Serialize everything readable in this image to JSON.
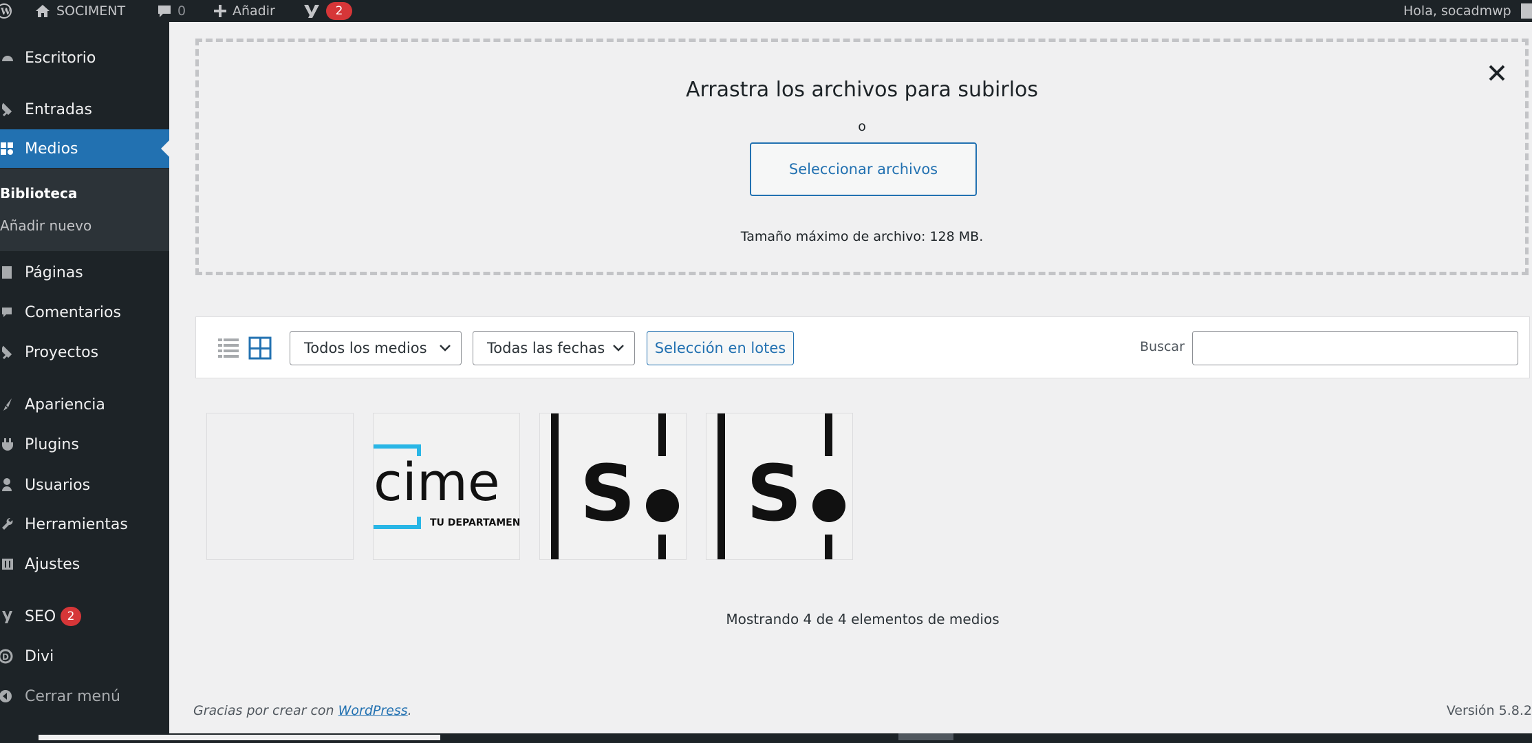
{
  "adminbar": {
    "site_name": "SOCIMENT",
    "comments_count": "0",
    "new_label": "Añadir",
    "yoast_badge": "2",
    "greeting": "Hola, socadmwp"
  },
  "sidebar": {
    "items": [
      {
        "label": "Escritorio",
        "icon": "gauge-icon"
      },
      {
        "label": "Entradas",
        "icon": "pin-icon"
      },
      {
        "label": "Medios",
        "icon": "media-icon"
      },
      {
        "label": "Páginas",
        "icon": "page-icon"
      },
      {
        "label": "Comentarios",
        "icon": "comment-icon"
      },
      {
        "label": "Proyectos",
        "icon": "pin-icon"
      },
      {
        "label": "Apariencia",
        "icon": "brush-icon"
      },
      {
        "label": "Plugins",
        "icon": "plugin-icon"
      },
      {
        "label": "Usuarios",
        "icon": "user-icon"
      },
      {
        "label": "Herramientas",
        "icon": "wrench-icon"
      },
      {
        "label": "Ajustes",
        "icon": "settings-icon"
      },
      {
        "label": "SEO",
        "icon": "yoast-icon",
        "badge": "2"
      },
      {
        "label": "Divi",
        "icon": "divi-icon"
      },
      {
        "label": "Cerrar menú",
        "icon": "collapse-icon"
      }
    ],
    "submenu": [
      {
        "label": "Biblioteca"
      },
      {
        "label": "Añadir nuevo"
      }
    ]
  },
  "uploader": {
    "title": "Arrastra los archivos para subirlos",
    "or": "o",
    "button": "Seleccionar archivos",
    "max_size": "Tamaño máximo de archivo: 128 MB."
  },
  "toolbar": {
    "filter_media": "Todos los medios",
    "filter_dates": "Todas las fechas",
    "bulk_select": "Selección en lotes",
    "search_label": "Buscar",
    "search_value": ""
  },
  "attachments": [
    {
      "kind": "blank"
    },
    {
      "kind": "cime-logo",
      "text": "cime",
      "subtext": "TU DEPARTAMENTO"
    },
    {
      "kind": "s-logo",
      "text": "S"
    },
    {
      "kind": "s-logo",
      "text": "S"
    }
  ],
  "count_text": "Mostrando 4 de 4 elementos de medios",
  "footer": {
    "thanks_prefix": "Gracias por crear con",
    "link": "WordPress",
    "thanks_suffix": ".",
    "version": "Versión 5.8.2"
  },
  "colors": {
    "adminbar_bg": "#1d2327",
    "accent": "#2271b1",
    "badge": "#d63638",
    "cime_cyan": "#29b6e6"
  }
}
